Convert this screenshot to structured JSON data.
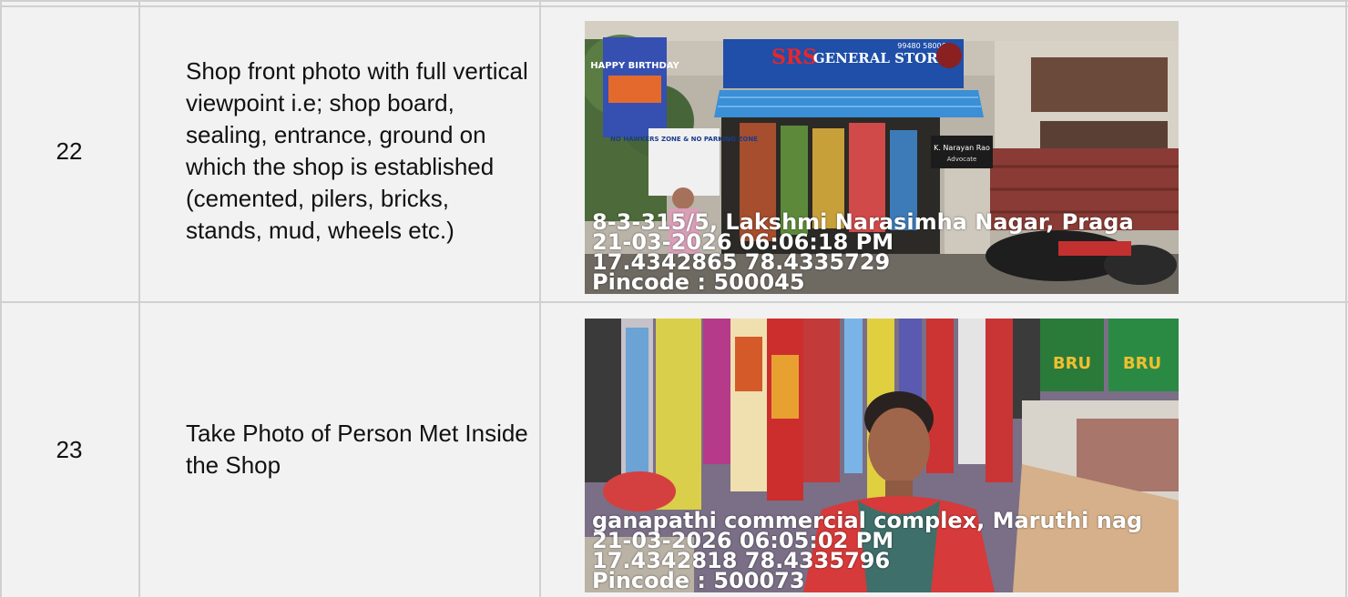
{
  "rows": [
    {
      "number": "22",
      "description": "Shop front photo with full vertical viewpoint i.e; shop board, sealing, entrance, ground on which the shop is established (cemented, pilers, bricks, stands, mud, wheels etc.)",
      "photo": {
        "sign_brand": "SRS",
        "sign_title": "GENERAL STORE",
        "sign_phone": "99480 58006",
        "banner_text": "HAPPY BIRTHDAY",
        "notice_text": "NO HAWKERS ZONE & NO PARKING ZONE",
        "nameplate_text": "K. Narayan Rao",
        "nameplate_sub": "Advocate",
        "address": "8-3-315/5, Lakshmi Narasimha Nagar, Praga",
        "datetime": "21-03-2026 06:06:18 PM",
        "coords": "17.4342865 78.4335729",
        "pincode": "Pincode : 500045"
      }
    },
    {
      "number": "23",
      "description": "Take Photo of Person Met Inside the Shop",
      "photo": {
        "brand_text": "BRU",
        "address": "ganapathi commercial complex, Maruthi nag",
        "datetime": "21-03-2026 06:05:02 PM",
        "coords": "17.4342818 78.4335796",
        "pincode": "Pincode : 500073"
      }
    }
  ],
  "colors": {
    "row_bg": "#f2f2f2",
    "border": "#d0d0d0",
    "sign_blue": "#1f4fa8",
    "awning_blue": "#3a8fd6"
  }
}
